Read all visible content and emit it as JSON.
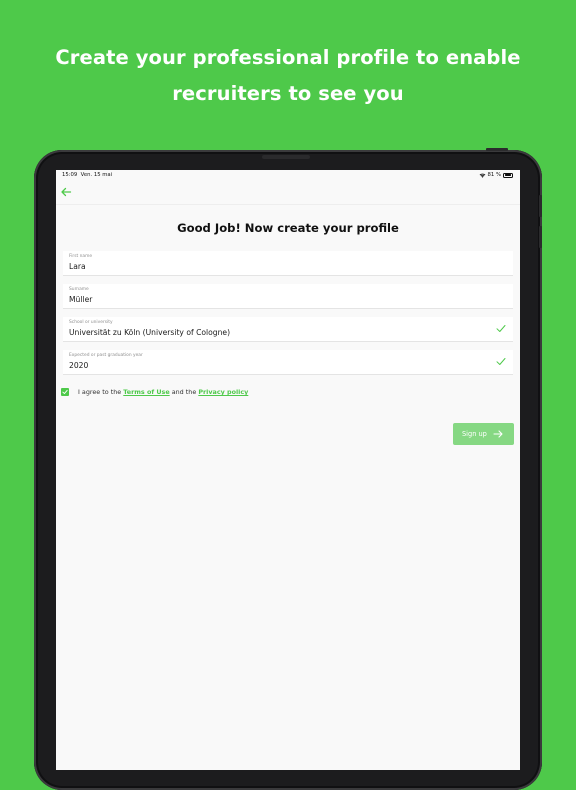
{
  "headline": "Create your professional profile to enable recruiters to see you",
  "status_bar": {
    "time": "15:09",
    "date": "Ven. 15 mai",
    "battery": "81 %"
  },
  "form": {
    "title": "Good Job! Now create your profile",
    "fields": [
      {
        "label": "First name",
        "value": "Lara",
        "validated": false
      },
      {
        "label": "Surname",
        "value": "Müller",
        "validated": false
      },
      {
        "label": "School or university",
        "value": "Universität zu Köln (University of Cologne)",
        "validated": true
      },
      {
        "label": "Expected or past graduation year",
        "value": "2020",
        "validated": true
      }
    ],
    "terms": {
      "checked": true,
      "prefix": "I agree to the",
      "terms_link": "Terms of Use",
      "middle": "and the",
      "privacy_link": "Privacy policy"
    },
    "signup_label": "Sign up"
  },
  "colors": {
    "accent": "#4ec94a",
    "button_disabled": "#86d883"
  },
  "icons": [
    "back-arrow-icon",
    "check-icon",
    "wifi-icon",
    "battery-icon",
    "arrow-right-icon"
  ]
}
